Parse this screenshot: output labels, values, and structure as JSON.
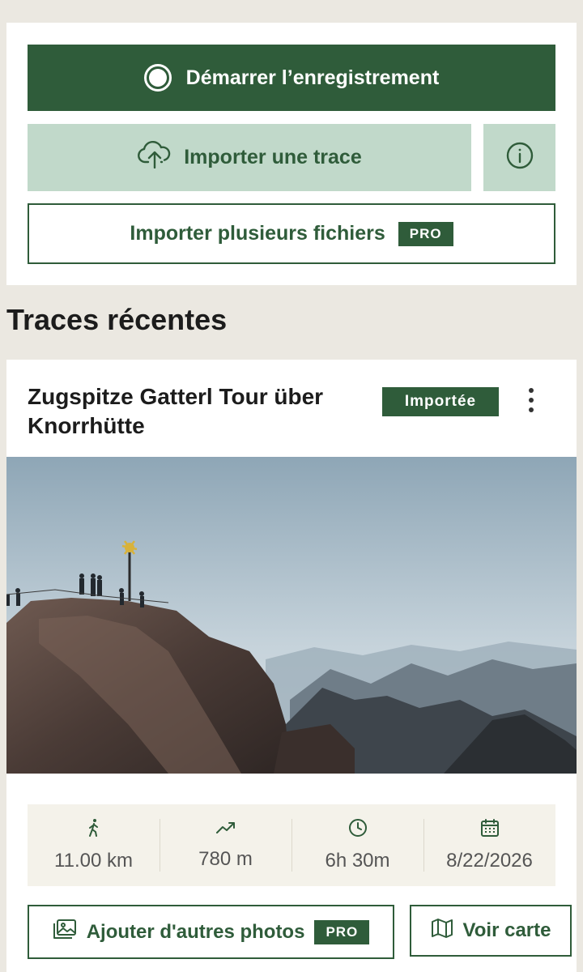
{
  "actions": {
    "record_label": "Démarrer l’enregistrement",
    "import_label": "Importer une trace",
    "multi_label": "Importer plusieurs fichiers",
    "pro_badge": "PRO"
  },
  "recent": {
    "section_title": "Traces récentes"
  },
  "trace": {
    "title": "Zugspitze Gatterl Tour über Knorrhütte",
    "status": "Importée",
    "stats": {
      "distance": "11.00 km",
      "elevation": "780 m",
      "duration": "6h 30m",
      "date": "8/22/2026"
    },
    "photos_button": "Ajouter d'autres photos",
    "photos_pro": "PRO",
    "map_button": "Voir carte"
  },
  "colors": {
    "primary": "#2f5c3a",
    "secondary": "#c1d9ca",
    "background": "#ebe8e1",
    "stats_bg": "#f4f2ea"
  },
  "icons": [
    "record-icon",
    "upload-cloud-icon",
    "info-icon",
    "more-vertical-icon",
    "hiker-icon",
    "trend-up-icon",
    "clock-icon",
    "calendar-icon",
    "image-icon",
    "map-icon"
  ]
}
